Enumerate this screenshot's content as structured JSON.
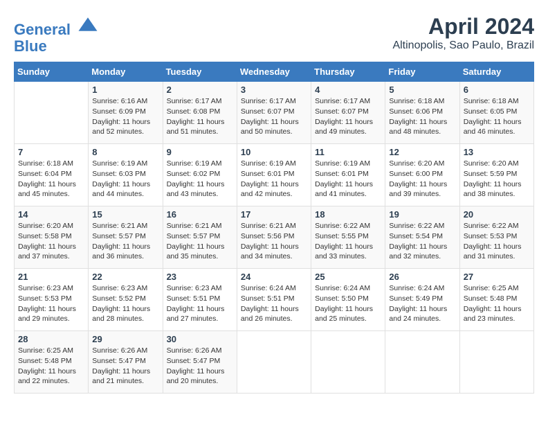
{
  "header": {
    "logo_line1": "General",
    "logo_line2": "Blue",
    "month": "April 2024",
    "location": "Altinopolis, Sao Paulo, Brazil"
  },
  "columns": [
    "Sunday",
    "Monday",
    "Tuesday",
    "Wednesday",
    "Thursday",
    "Friday",
    "Saturday"
  ],
  "weeks": [
    [
      {
        "day": "",
        "info": ""
      },
      {
        "day": "1",
        "info": "Sunrise: 6:16 AM\nSunset: 6:09 PM\nDaylight: 11 hours\nand 52 minutes."
      },
      {
        "day": "2",
        "info": "Sunrise: 6:17 AM\nSunset: 6:08 PM\nDaylight: 11 hours\nand 51 minutes."
      },
      {
        "day": "3",
        "info": "Sunrise: 6:17 AM\nSunset: 6:07 PM\nDaylight: 11 hours\nand 50 minutes."
      },
      {
        "day": "4",
        "info": "Sunrise: 6:17 AM\nSunset: 6:07 PM\nDaylight: 11 hours\nand 49 minutes."
      },
      {
        "day": "5",
        "info": "Sunrise: 6:18 AM\nSunset: 6:06 PM\nDaylight: 11 hours\nand 48 minutes."
      },
      {
        "day": "6",
        "info": "Sunrise: 6:18 AM\nSunset: 6:05 PM\nDaylight: 11 hours\nand 46 minutes."
      }
    ],
    [
      {
        "day": "7",
        "info": "Sunrise: 6:18 AM\nSunset: 6:04 PM\nDaylight: 11 hours\nand 45 minutes."
      },
      {
        "day": "8",
        "info": "Sunrise: 6:19 AM\nSunset: 6:03 PM\nDaylight: 11 hours\nand 44 minutes."
      },
      {
        "day": "9",
        "info": "Sunrise: 6:19 AM\nSunset: 6:02 PM\nDaylight: 11 hours\nand 43 minutes."
      },
      {
        "day": "10",
        "info": "Sunrise: 6:19 AM\nSunset: 6:01 PM\nDaylight: 11 hours\nand 42 minutes."
      },
      {
        "day": "11",
        "info": "Sunrise: 6:19 AM\nSunset: 6:01 PM\nDaylight: 11 hours\nand 41 minutes."
      },
      {
        "day": "12",
        "info": "Sunrise: 6:20 AM\nSunset: 6:00 PM\nDaylight: 11 hours\nand 39 minutes."
      },
      {
        "day": "13",
        "info": "Sunrise: 6:20 AM\nSunset: 5:59 PM\nDaylight: 11 hours\nand 38 minutes."
      }
    ],
    [
      {
        "day": "14",
        "info": "Sunrise: 6:20 AM\nSunset: 5:58 PM\nDaylight: 11 hours\nand 37 minutes."
      },
      {
        "day": "15",
        "info": "Sunrise: 6:21 AM\nSunset: 5:57 PM\nDaylight: 11 hours\nand 36 minutes."
      },
      {
        "day": "16",
        "info": "Sunrise: 6:21 AM\nSunset: 5:57 PM\nDaylight: 11 hours\nand 35 minutes."
      },
      {
        "day": "17",
        "info": "Sunrise: 6:21 AM\nSunset: 5:56 PM\nDaylight: 11 hours\nand 34 minutes."
      },
      {
        "day": "18",
        "info": "Sunrise: 6:22 AM\nSunset: 5:55 PM\nDaylight: 11 hours\nand 33 minutes."
      },
      {
        "day": "19",
        "info": "Sunrise: 6:22 AM\nSunset: 5:54 PM\nDaylight: 11 hours\nand 32 minutes."
      },
      {
        "day": "20",
        "info": "Sunrise: 6:22 AM\nSunset: 5:53 PM\nDaylight: 11 hours\nand 31 minutes."
      }
    ],
    [
      {
        "day": "21",
        "info": "Sunrise: 6:23 AM\nSunset: 5:53 PM\nDaylight: 11 hours\nand 29 minutes."
      },
      {
        "day": "22",
        "info": "Sunrise: 6:23 AM\nSunset: 5:52 PM\nDaylight: 11 hours\nand 28 minutes."
      },
      {
        "day": "23",
        "info": "Sunrise: 6:23 AM\nSunset: 5:51 PM\nDaylight: 11 hours\nand 27 minutes."
      },
      {
        "day": "24",
        "info": "Sunrise: 6:24 AM\nSunset: 5:51 PM\nDaylight: 11 hours\nand 26 minutes."
      },
      {
        "day": "25",
        "info": "Sunrise: 6:24 AM\nSunset: 5:50 PM\nDaylight: 11 hours\nand 25 minutes."
      },
      {
        "day": "26",
        "info": "Sunrise: 6:24 AM\nSunset: 5:49 PM\nDaylight: 11 hours\nand 24 minutes."
      },
      {
        "day": "27",
        "info": "Sunrise: 6:25 AM\nSunset: 5:48 PM\nDaylight: 11 hours\nand 23 minutes."
      }
    ],
    [
      {
        "day": "28",
        "info": "Sunrise: 6:25 AM\nSunset: 5:48 PM\nDaylight: 11 hours\nand 22 minutes."
      },
      {
        "day": "29",
        "info": "Sunrise: 6:26 AM\nSunset: 5:47 PM\nDaylight: 11 hours\nand 21 minutes."
      },
      {
        "day": "30",
        "info": "Sunrise: 6:26 AM\nSunset: 5:47 PM\nDaylight: 11 hours\nand 20 minutes."
      },
      {
        "day": "",
        "info": ""
      },
      {
        "day": "",
        "info": ""
      },
      {
        "day": "",
        "info": ""
      },
      {
        "day": "",
        "info": ""
      }
    ]
  ]
}
